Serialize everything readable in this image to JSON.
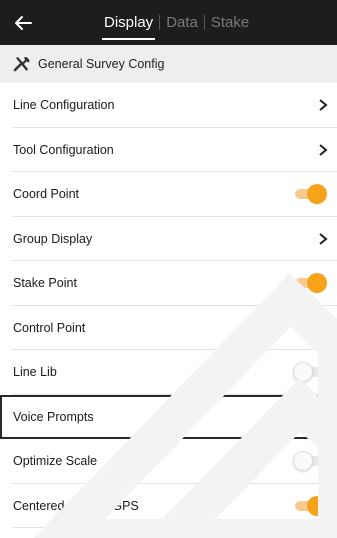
{
  "header": {
    "back_icon": "arrow-left-icon",
    "tabs": [
      {
        "label": "Display",
        "active": true
      },
      {
        "label": "Data",
        "active": false
      },
      {
        "label": "Stake",
        "active": false
      }
    ]
  },
  "section": {
    "icon": "tools-icon",
    "title": "General Survey Config"
  },
  "settings": [
    {
      "label": "Line Configuration",
      "control": "chevron"
    },
    {
      "label": "Tool Configuration",
      "control": "chevron"
    },
    {
      "label": "Coord Point",
      "control": "toggle",
      "on": true
    },
    {
      "label": "Group Display",
      "control": "chevron"
    },
    {
      "label": "Stake Point",
      "control": "toggle",
      "on": true
    },
    {
      "label": "Control Point",
      "control": "toggle",
      "on": true
    },
    {
      "label": "Line Lib",
      "control": "toggle",
      "on": false
    },
    {
      "label": "Voice Prompts",
      "control": "toggle",
      "on": true,
      "highlighted": true
    },
    {
      "label": "Optimize Scale",
      "control": "toggle",
      "on": false
    },
    {
      "label": "Centered Display GPS",
      "control": "toggle",
      "on": true
    }
  ],
  "colors": {
    "header_bg": "#1d1d1f",
    "accent": "#f7a21b"
  }
}
